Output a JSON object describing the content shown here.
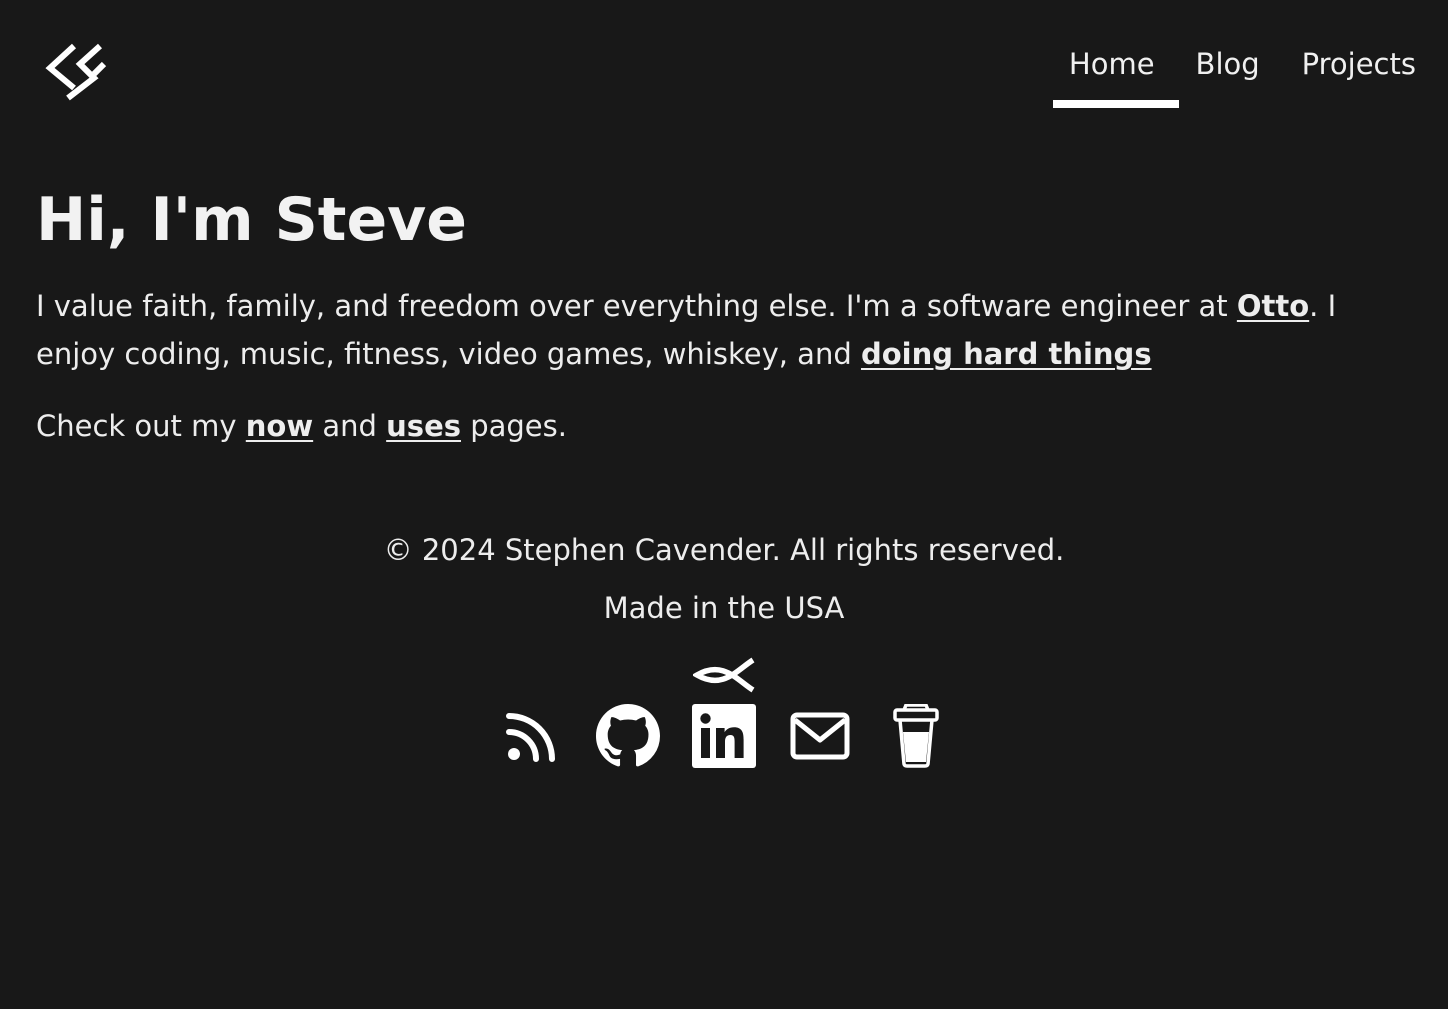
{
  "header": {
    "logo_icon": "sc-monogram-logo",
    "nav": [
      {
        "label": "Home",
        "active": true
      },
      {
        "label": "Blog",
        "active": false
      },
      {
        "label": "Projects",
        "active": false
      }
    ]
  },
  "main": {
    "title": "Hi, I'm Steve",
    "intro": {
      "before_otto": "I value faith, family, and freedom over everything else. I'm a software engineer at ",
      "otto_link": "Otto",
      "after_otto": ". I enjoy coding, music, fitness, video games, whiskey, and ",
      "hard_things_link": "doing hard things"
    },
    "pages_line": {
      "prefix": "Check out my ",
      "now_link": "now",
      "middle": " and ",
      "uses_link": "uses",
      "suffix": " pages."
    }
  },
  "footer": {
    "copyright": "© 2024 Stephen Cavender. All rights reserved.",
    "made_in": "Made in the USA",
    "faith_icon": "ichthys-icon",
    "socials": [
      {
        "icon": "rss-icon"
      },
      {
        "icon": "github-icon"
      },
      {
        "icon": "linkedin-icon"
      },
      {
        "icon": "email-icon"
      },
      {
        "icon": "coffee-cup-icon"
      }
    ]
  },
  "colors": {
    "background": "#181818",
    "text": "#ededed",
    "accent": "#ffffff"
  }
}
